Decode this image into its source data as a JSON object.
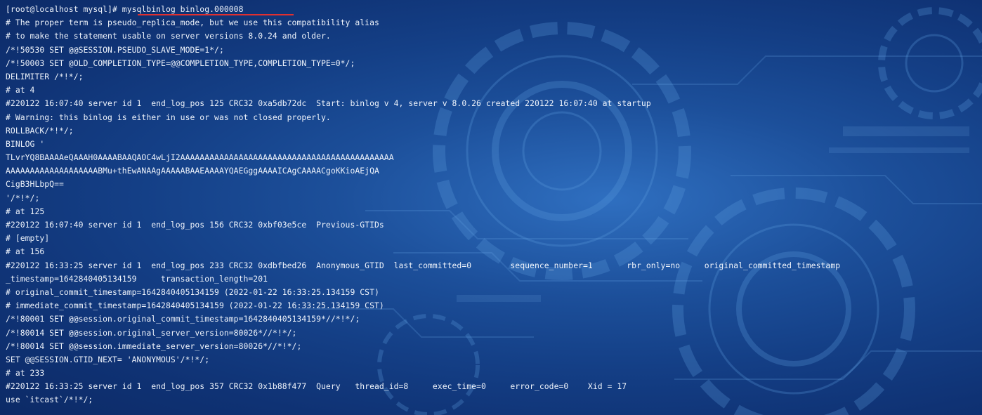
{
  "terminal": {
    "lines": [
      "[root@localhost mysql]# mysqlbinlog binlog.000008",
      "# The proper term is pseudo_replica_mode, but we use this compatibility alias",
      "# to make the statement usable on server versions 8.0.24 and older.",
      "/*!50530 SET @@SESSION.PSEUDO_SLAVE_MODE=1*/;",
      "/*!50003 SET @OLD_COMPLETION_TYPE=@@COMPLETION_TYPE,COMPLETION_TYPE=0*/;",
      "DELIMITER /*!*/;",
      "# at 4",
      "#220122 16:07:40 server id 1  end_log_pos 125 CRC32 0xa5db72dc  Start: binlog v 4, server v 8.0.26 created 220122 16:07:40 at startup",
      "# Warning: this binlog is either in use or was not closed properly.",
      "ROLLBACK/*!*/;",
      "BINLOG '",
      "TLvrYQ8BAAAAeQAAAH0AAAABAAQAOC4wLjI2AAAAAAAAAAAAAAAAAAAAAAAAAAAAAAAAAAAAAAAAAAAA",
      "AAAAAAAAAAAAAAAAAAABMu+thEwANAAgAAAAABAAEAAAAYQAEGggAAAAICAgCAAAACgoKKioAEjQA",
      "CigB3HLbpQ==",
      "'/*!*/;",
      "# at 125",
      "#220122 16:07:40 server id 1  end_log_pos 156 CRC32 0xbf03e5ce  Previous-GTIDs",
      "# [empty]",
      "# at 156",
      "#220122 16:33:25 server id 1  end_log_pos 233 CRC32 0xdbfbed26  Anonymous_GTID  last_committed=0        sequence_number=1       rbr_only=no     original_committed_timestamp",
      "_timestamp=1642840405134159     transaction_length=201",
      "# original_commit_timestamp=1642840405134159 (2022-01-22 16:33:25.134159 CST)",
      "# immediate_commit_timestamp=1642840405134159 (2022-01-22 16:33:25.134159 CST)",
      "/*!80001 SET @@session.original_commit_timestamp=1642840405134159*//*!*/;",
      "/*!80014 SET @@session.original_server_version=80026*//*!*/;",
      "/*!80014 SET @@session.immediate_server_version=80026*//*!*/;",
      "SET @@SESSION.GTID_NEXT= 'ANONYMOUS'/*!*/;",
      "# at 233",
      "#220122 16:33:25 server id 1  end_log_pos 357 CRC32 0x1b88f477  Query   thread_id=8     exec_time=0     error_code=0    Xid = 17",
      "use `itcast`/*!*/;"
    ]
  },
  "colors": {
    "text": "#eef3fb",
    "underline": "#e03030",
    "background": "#1c4f9a"
  }
}
